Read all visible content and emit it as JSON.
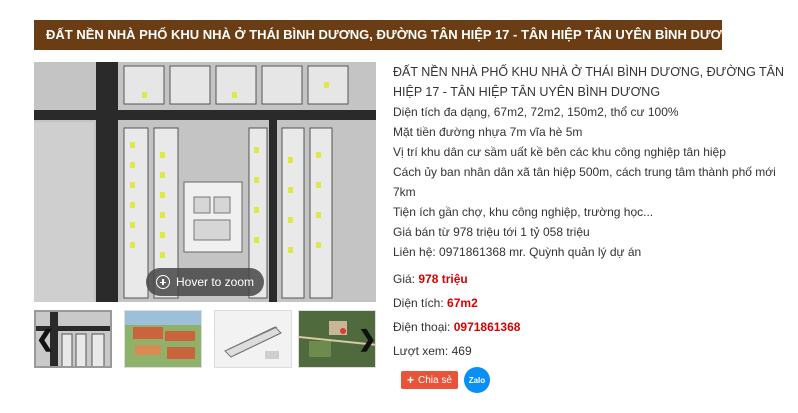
{
  "title": "ĐẤT NỀN NHÀ PHỐ KHU NHÀ Ở THÁI BÌNH DƯƠNG, ĐƯỜNG TÂN HIỆP 17 - TÂN HIỆP TÂN UYÊN BÌNH DƯƠNG",
  "gallery": {
    "zoom_label": "Hover to zoom",
    "prev_arrow": "❮",
    "next_arrow": "❯"
  },
  "description": {
    "heading": "ĐẤT NỀN NHÀ PHỐ KHU NHÀ Ở THÁI BÌNH DƯƠNG, ĐƯỜNG TÂN HIỆP 17 - TÂN HIỆP TÂN UYÊN BÌNH DƯƠNG",
    "lines": [
      "Diện tích đa dạng, 67m2, 72m2, 150m2, thổ cư 100%",
      "Mặt tiền đường nhựa 7m vĩa hè 5m",
      "Vị trí khu dân cư sầm uất kề bên các khu công nghiệp tân hiệp",
      "Cách ủy ban nhân dân xã tân hiệp 500m, cách trung tâm thành phố mới 7km",
      "Tiện ích gần chợ, khu công nghiệp, trường học...",
      "Giá bán từ 978 triệu tới 1 tỷ 058 triệu",
      "Liên hệ: 0971861368 mr. Quỳnh quản lý dự án"
    ]
  },
  "details": {
    "price_label": "Giá:",
    "price_value": "978 triệu",
    "area_label": "Diện tích:",
    "area_value": "67m2",
    "phone_label": "Điện thoại:",
    "phone_value": "0971861368",
    "views_label": "Lượt xem:",
    "views_value": "469"
  },
  "share": {
    "share_label": "Chia sẻ",
    "zalo_label": "Zalo"
  },
  "colors": {
    "title_bar": "#6b3d14",
    "highlight_value": "#d50000",
    "share_button": "#e8533a",
    "zalo_button": "#0a8ff7"
  }
}
